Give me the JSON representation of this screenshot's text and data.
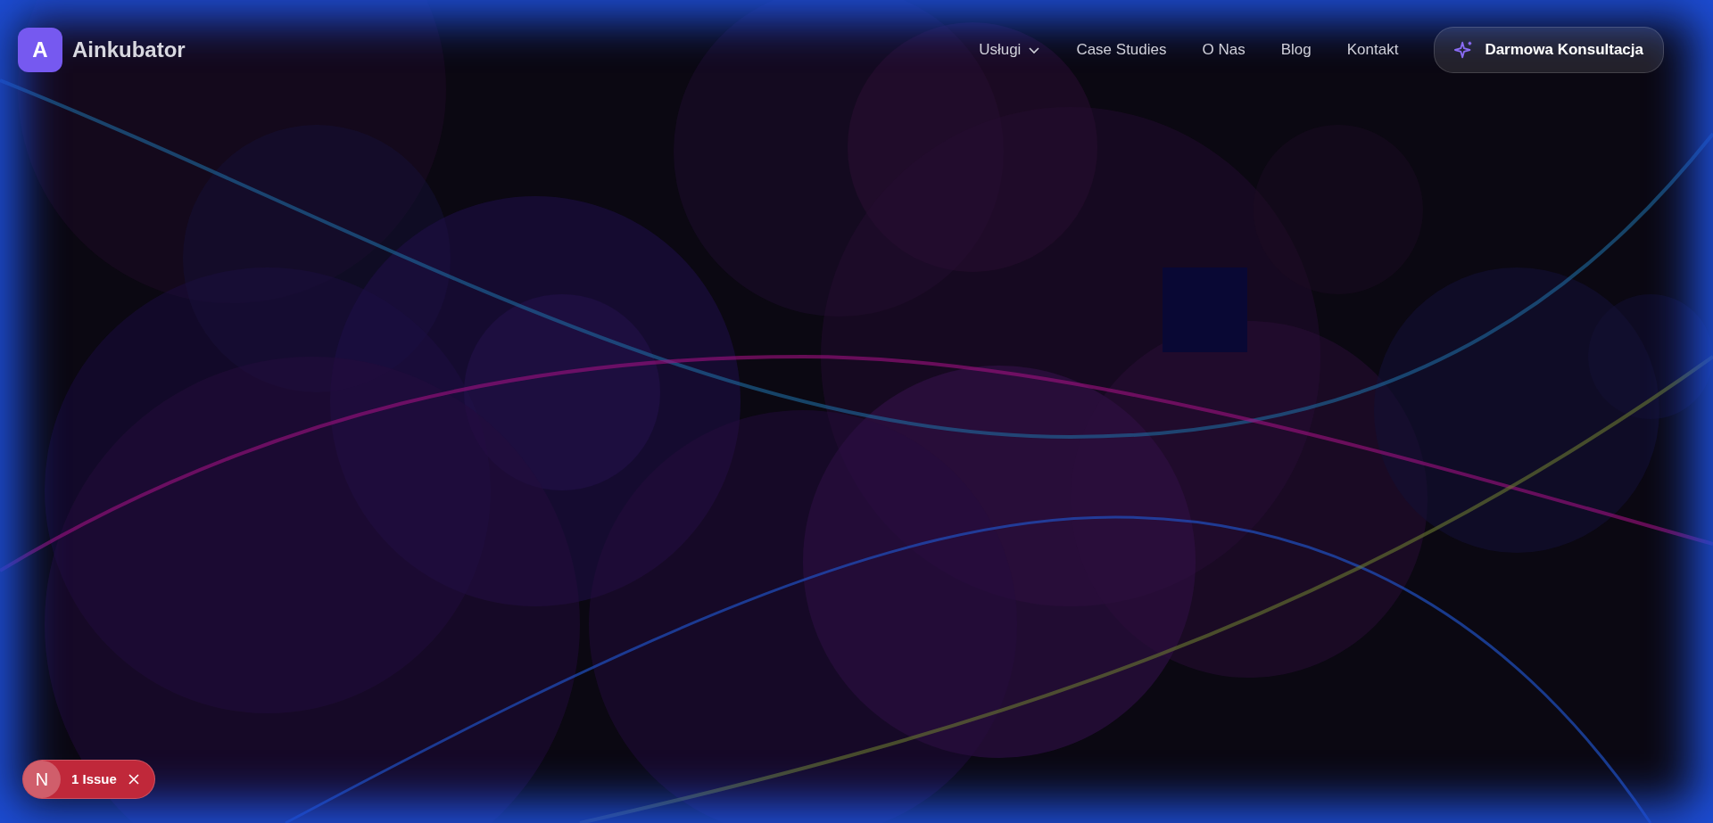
{
  "logo": {
    "letter": "A",
    "name": "Ainkubator"
  },
  "nav": [
    {
      "label": "Usługi",
      "kind": "dropdown"
    },
    {
      "label": "Case Studies",
      "kind": "link"
    },
    {
      "label": "O Nas",
      "kind": "link"
    },
    {
      "label": "Blog",
      "kind": "link"
    },
    {
      "label": "Kontakt",
      "kind": "link"
    }
  ],
  "cta": {
    "label": "Darmowa Konsultacja"
  },
  "issue_badge": {
    "letter": "N",
    "label": "1 Issue"
  }
}
